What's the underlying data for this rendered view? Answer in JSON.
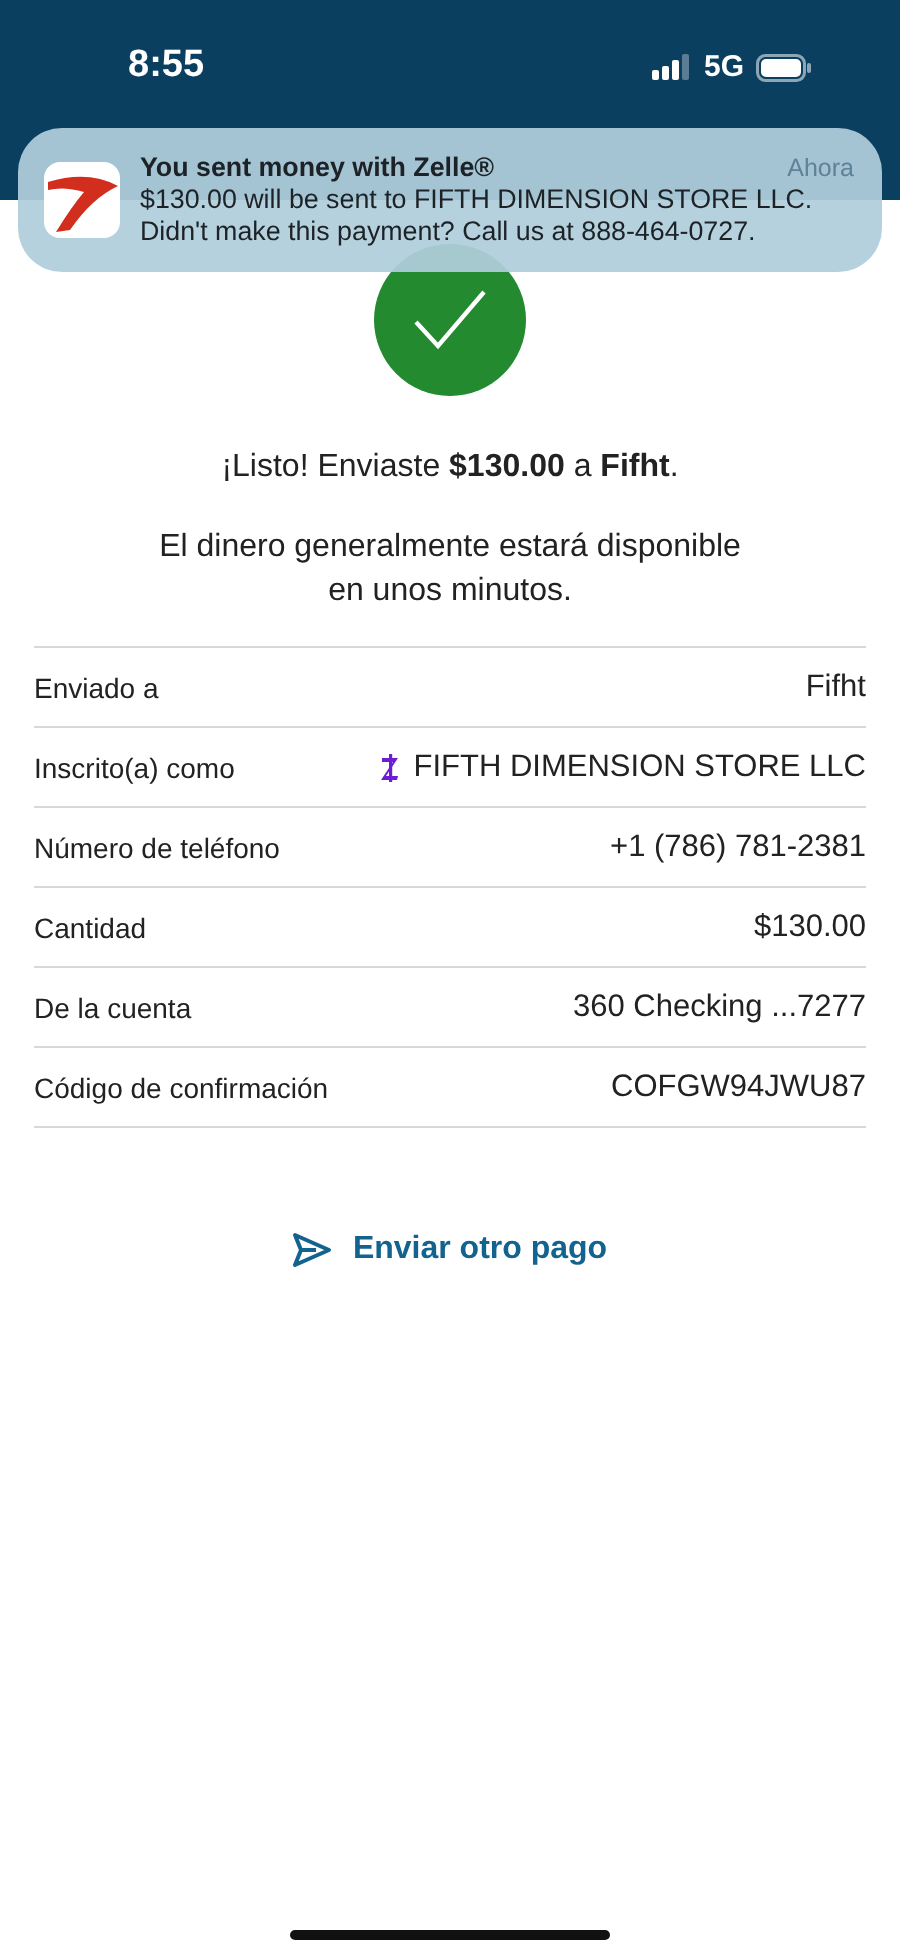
{
  "status_bar": {
    "time": "8:55",
    "network": "5G"
  },
  "notification": {
    "title": "You sent money with Zelle®",
    "time": "Ahora",
    "body": "$130.00 will be sent to FIFTH DIMENSION STORE LLC. Didn't make this payment? Call us at 888-464-0727."
  },
  "confirmation": {
    "message": "¡Listo! Enviaste **$130.00** a **Fifht**.",
    "note": "El dinero generalmente estará disponible en unos minutos."
  },
  "details": [
    {
      "kind": "plain",
      "label": "Enviado a",
      "value": "Fifht"
    },
    {
      "kind": "zelle",
      "label": "Inscrito(a) como",
      "value": "FIFTH DIMENSION STORE LLC"
    },
    {
      "kind": "plain",
      "label": "Número de teléfono",
      "value": "+1 (786) 781-2381"
    },
    {
      "kind": "plain",
      "label": "Cantidad",
      "value": "$130.00"
    },
    {
      "kind": "plain",
      "label": "De la cuenta",
      "value": "360 Checking ...7277"
    },
    {
      "kind": "plain",
      "label": "Código de confirmación",
      "value": "COFGW94JWU87"
    }
  ],
  "action": {
    "label": "Enviar otro pago"
  }
}
